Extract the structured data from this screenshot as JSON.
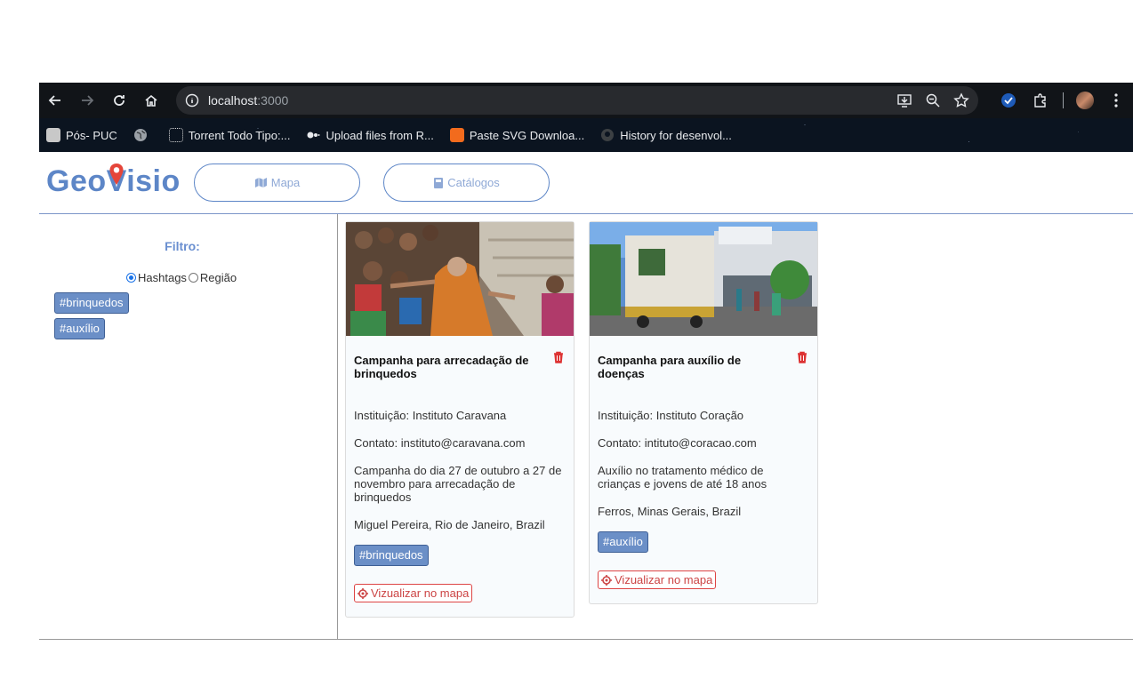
{
  "browser": {
    "url_host": "localhost",
    "url_port": ":3000",
    "bookmarks": [
      {
        "label": "Pós- PUC",
        "icon": "puc-icon"
      },
      {
        "label": "",
        "icon": "globe-icon"
      },
      {
        "label": "Torrent Todo Tipo:...",
        "icon": "torrent-icon"
      },
      {
        "label": "Upload files from R...",
        "icon": "upload-icon"
      },
      {
        "label": "Paste SVG Downloa...",
        "icon": "svg-icon"
      },
      {
        "label": "History for desenvol...",
        "icon": "github-icon"
      }
    ]
  },
  "app": {
    "logo": "GeoVisio",
    "nav": {
      "map_label": "Mapa",
      "catalog_label": "Catálogos"
    },
    "sidebar": {
      "filter_title": "Filtro:",
      "radio_hashtags": "Hashtags",
      "radio_region": "Região",
      "tags": [
        "#brinquedos",
        "#auxílio"
      ]
    },
    "cards": [
      {
        "title": "Campanha para arrecadação de brinquedos",
        "institution": "Instituição: Instituto Caravana",
        "contact": "Contato: instituto@caravana.com",
        "description": "Campanha do dia 27 de outubro a 27 de novembro para arrecadação de brinquedos",
        "location": "Miguel Pereira, Rio de Janeiro, Brazil",
        "tag": "#brinquedos",
        "map_button": "Vizualizar no mapa"
      },
      {
        "title": "Campanha para auxílio de doenças",
        "institution": "Instituição: Instituto Coração",
        "contact": "Contato: intituto@coracao.com",
        "description": "Auxílio no tratamento médico de crianças e jovens de até 18 anos",
        "location": "Ferros, Minas Gerais, Brazil",
        "tag": "#auxílio",
        "map_button": "Vizualizar no mapa"
      }
    ]
  },
  "colors": {
    "brand": "#5d86c7",
    "tag_bg": "#6b8fc7",
    "danger": "#d44"
  }
}
